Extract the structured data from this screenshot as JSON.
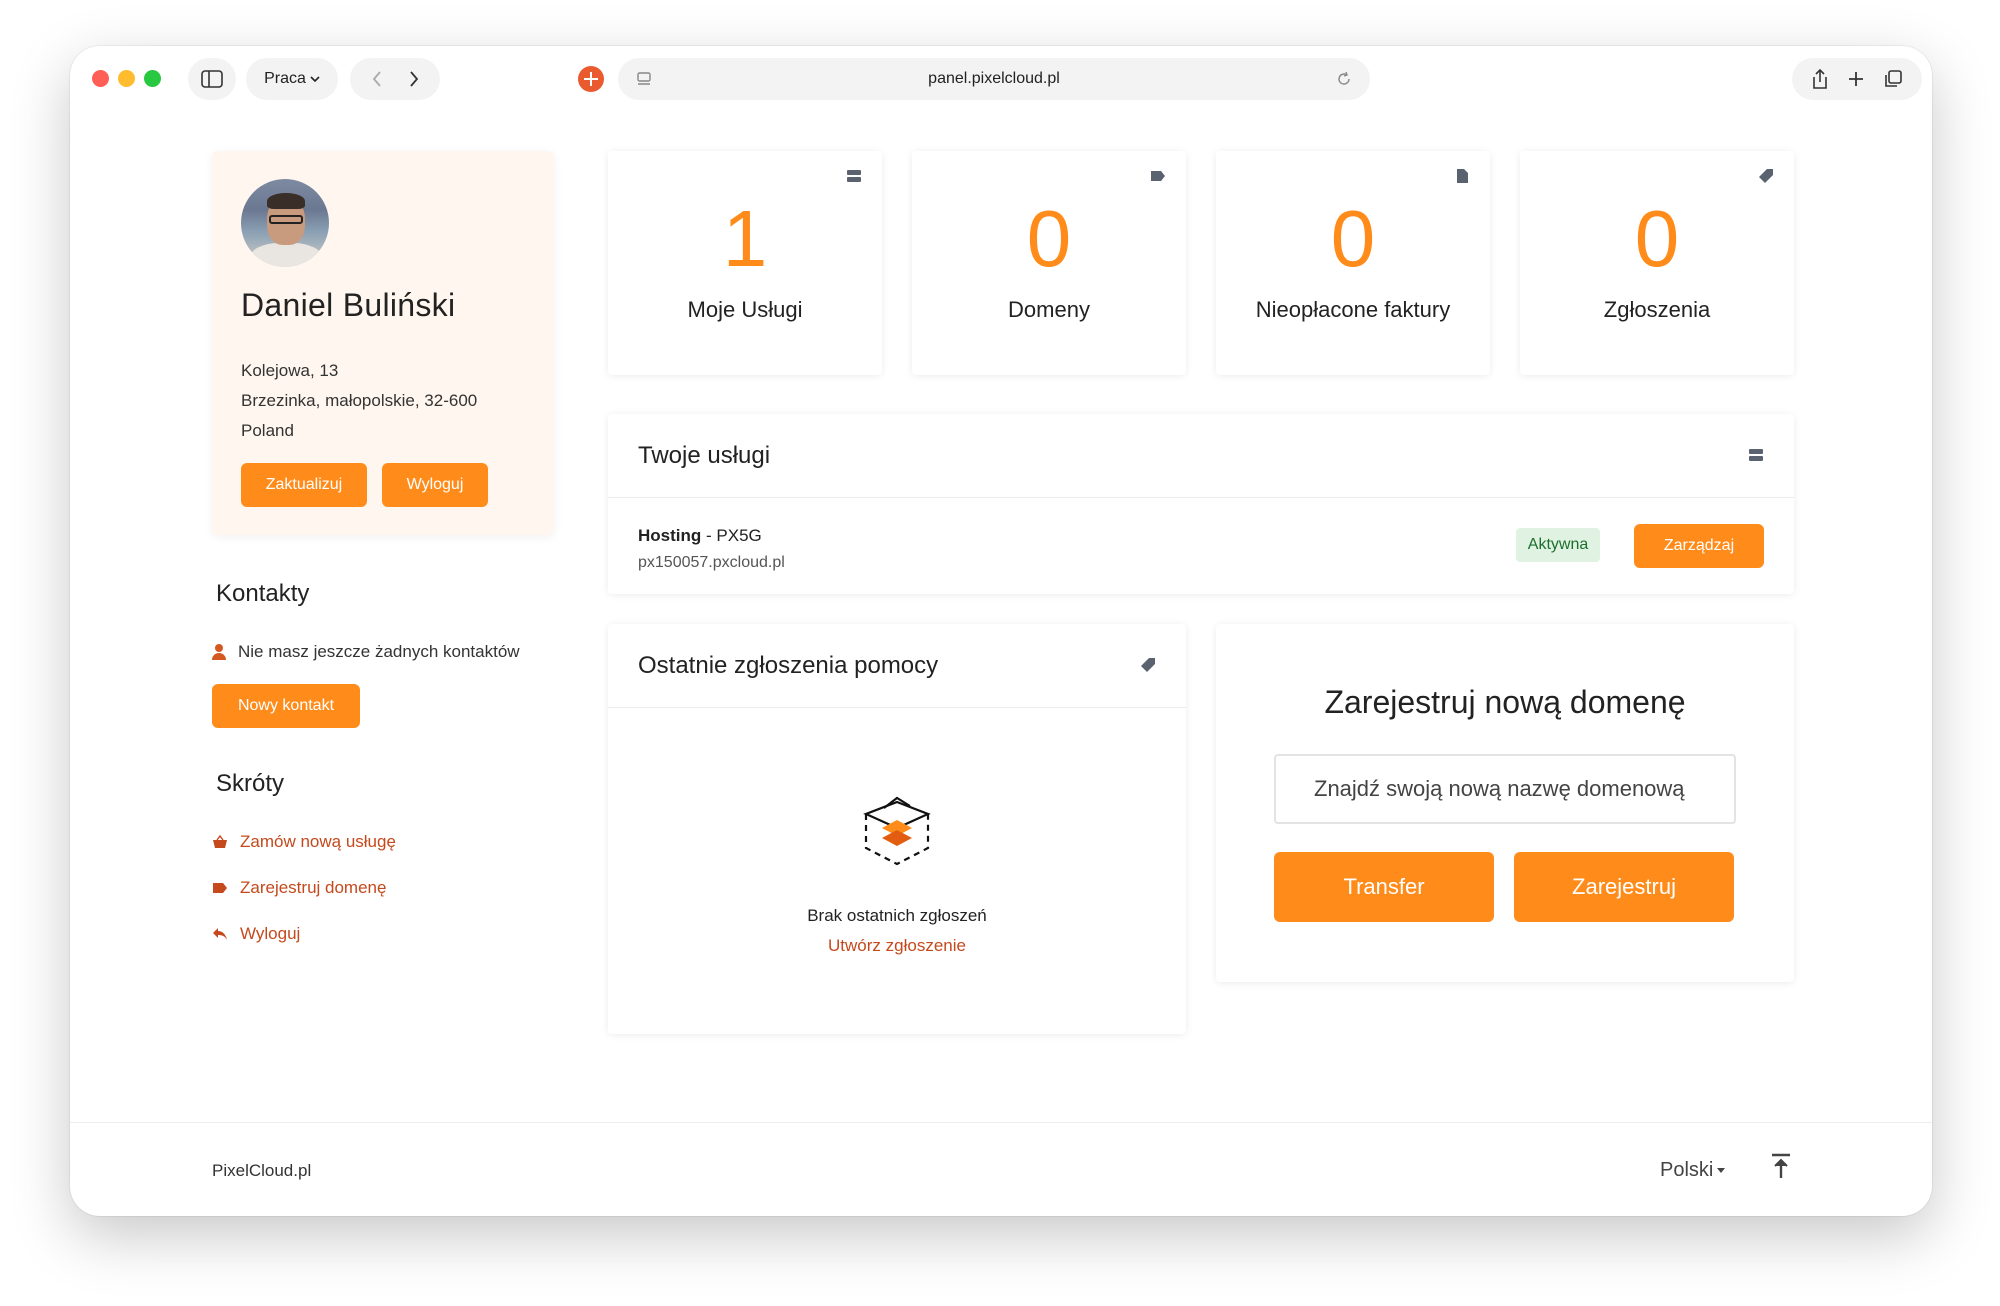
{
  "browser": {
    "tab_group": "Praca",
    "url": "panel.pixelcloud.pl"
  },
  "profile": {
    "name": "Daniel Buliński",
    "address_line1": "Kolejowa, 13",
    "address_line2": "Brzezinka, małopolskie, 32-600",
    "address_line3": "Poland",
    "update_label": "Zaktualizuj",
    "logout_label": "Wyloguj"
  },
  "contacts": {
    "title": "Kontakty",
    "empty_text": "Nie masz jeszcze żadnych kontaktów",
    "new_contact_label": "Nowy kontakt"
  },
  "shortcuts": {
    "title": "Skróty",
    "items": [
      {
        "label": "Zamów nową usługę",
        "icon": "basket-icon"
      },
      {
        "label": "Zarejestruj domenę",
        "icon": "tag-icon"
      },
      {
        "label": "Wyloguj",
        "icon": "reply-icon"
      }
    ]
  },
  "stats": [
    {
      "value": "1",
      "label": "Moje Usługi",
      "icon": "server-icon"
    },
    {
      "value": "0",
      "label": "Domeny",
      "icon": "tag-icon"
    },
    {
      "value": "0",
      "label": "Nieopłacone faktury",
      "icon": "document-icon"
    },
    {
      "value": "0",
      "label": "Zgłoszenia",
      "icon": "ticket-icon"
    }
  ],
  "services": {
    "title": "Twoje usługi",
    "items": [
      {
        "type": "Hosting",
        "plan": " - PX5G",
        "domain": "px150057.pxcloud.pl",
        "status": "Aktywna",
        "manage_label": "Zarządzaj"
      }
    ]
  },
  "tickets": {
    "title": "Ostatnie zgłoszenia pomocy",
    "empty_text": "Brak ostatnich zgłoszeń",
    "create_label": "Utwórz zgłoszenie"
  },
  "domain_register": {
    "title": "Zarejestruj nową domenę",
    "placeholder": "Znajdź swoją nową nazwę domenową",
    "transfer_label": "Transfer",
    "register_label": "Zarejestruj"
  },
  "footer": {
    "brand": "PixelCloud.pl",
    "language": "Polski"
  },
  "colors": {
    "accent": "#ff8c1a",
    "link": "#c5491d",
    "status_active_bg": "#e0f3e3"
  }
}
